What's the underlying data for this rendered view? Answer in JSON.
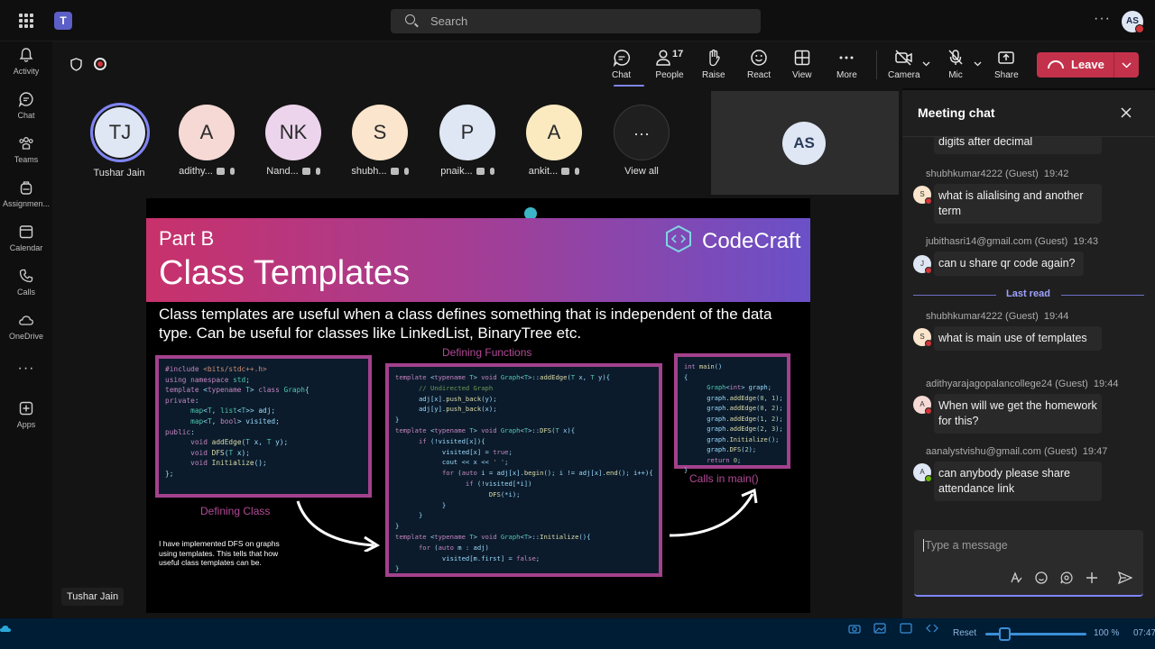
{
  "search": {
    "placeholder": "Search"
  },
  "user_initials": "AS",
  "rail": [
    {
      "label": "Activity",
      "icon": "bell-icon"
    },
    {
      "label": "Chat",
      "icon": "chat-icon"
    },
    {
      "label": "Teams",
      "icon": "teams-icon"
    },
    {
      "label": "Assignmen...",
      "icon": "backpack-icon"
    },
    {
      "label": "Calendar",
      "icon": "calendar-icon"
    },
    {
      "label": "Calls",
      "icon": "phone-icon"
    },
    {
      "label": "OneDrive",
      "icon": "cloud-icon"
    },
    {
      "label": "Apps",
      "icon": "add-app-icon"
    }
  ],
  "controls": {
    "chat": "Chat",
    "people": "People",
    "people_count": "17",
    "raise": "Raise",
    "react": "React",
    "view": "View",
    "more": "More",
    "camera": "Camera",
    "mic": "Mic",
    "share": "Share",
    "leave": "Leave"
  },
  "participants": [
    {
      "initials": "TJ",
      "name": "Tushar Jain",
      "color": "#dfe7f4"
    },
    {
      "initials": "A",
      "name": "adithy...",
      "color": "#f6d9d4"
    },
    {
      "initials": "NK",
      "name": "Nand...",
      "color": "#ecd4ec"
    },
    {
      "initials": "S",
      "name": "shubh...",
      "color": "#fbe5cc"
    },
    {
      "initials": "P",
      "name": "pnaik...",
      "color": "#dfe7f4"
    },
    {
      "initials": "A",
      "name": "ankit...",
      "color": "#fbeac0"
    }
  ],
  "view_all": {
    "icon": "ellipsis",
    "label": "View all"
  },
  "self_tile": {
    "initials": "AS"
  },
  "slide": {
    "part": "Part B",
    "title": "Class Templates",
    "brand": "CodeCraft",
    "description": "Class templates are useful when a class defines something that is independent of the data type. Can be useful for classes like LinkedList, BinaryTree etc.",
    "label_functions": "Defining Functions",
    "label_class": "Defining Class",
    "label_main": "Calls in main()",
    "note": "I have implemented DFS on graphs using templates. This tells that how useful class templates can be."
  },
  "presenter_tag": "Tushar Jain",
  "chat": {
    "title": "Meeting chat",
    "last_read": "Last read",
    "compose_placeholder": "Type a message",
    "messages": [
      {
        "text": "digits after decimal",
        "initial": ""
      },
      {
        "sender": "shubhkumar4222 (Guest)",
        "time": "19:42",
        "text": "what is alialising and another term",
        "initial": "S",
        "color": "#fbe5cc"
      },
      {
        "sender": "jubithasri14@gmail.com (Guest)",
        "time": "19:43",
        "text": "can u share qr code again?",
        "initial": "J",
        "color": "#dfe7f4"
      },
      {
        "sender": "shubhkumar4222 (Guest)",
        "time": "19:44",
        "text": "what is main use of templates",
        "initial": "S",
        "color": "#fbe5cc"
      },
      {
        "sender": "adithyarajagopalancollege24 (Guest)",
        "time": "19:44",
        "text": "When will we get the homework for this?",
        "initial": "A",
        "color": "#f6d9d4"
      },
      {
        "sender": "aanalystvishu@gmail.com (Guest)",
        "time": "19:47",
        "text": "can anybody please share attendance link",
        "initial": "A",
        "color": "#dfe7f4"
      }
    ]
  },
  "taskbar": {
    "reset": "Reset",
    "zoom": "100 %",
    "clock": "07:47"
  }
}
